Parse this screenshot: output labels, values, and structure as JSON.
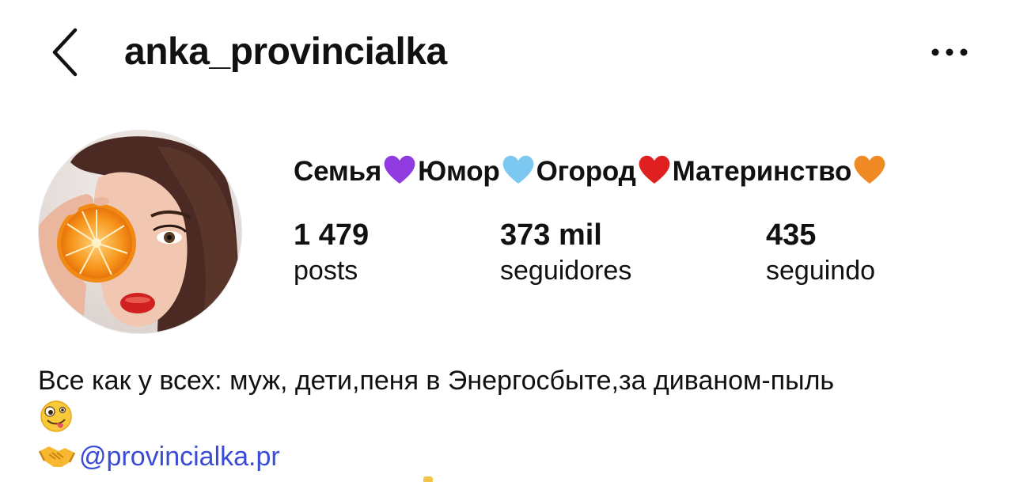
{
  "header": {
    "username": "anka_provincialka",
    "back_icon": "chevron-left-icon",
    "more_icon": "more-dots-icon"
  },
  "profile": {
    "avatar_icon": "avatar",
    "category": {
      "items": [
        "Семья",
        "Юмор",
        "Огород",
        "Материнство"
      ],
      "hearts": [
        "#8f3be0",
        "#7cc8f0",
        "#e02020",
        "#f08a24"
      ]
    },
    "stats": {
      "posts": {
        "value": "1 479",
        "label": "posts"
      },
      "followers": {
        "value": "373 mil",
        "label": "seguidores"
      },
      "following": {
        "value": "435",
        "label": "seguindo"
      }
    }
  },
  "bio": {
    "text": "Все как у всех: муж, дети,пеня в Энергосбыте,за диваном-пыль",
    "emoji": "zany-face-emoji",
    "link_emoji": "handshake-emoji",
    "link": "@provincialka.pr"
  },
  "colors": {
    "text": "#111111",
    "link": "#3a4bd6"
  }
}
